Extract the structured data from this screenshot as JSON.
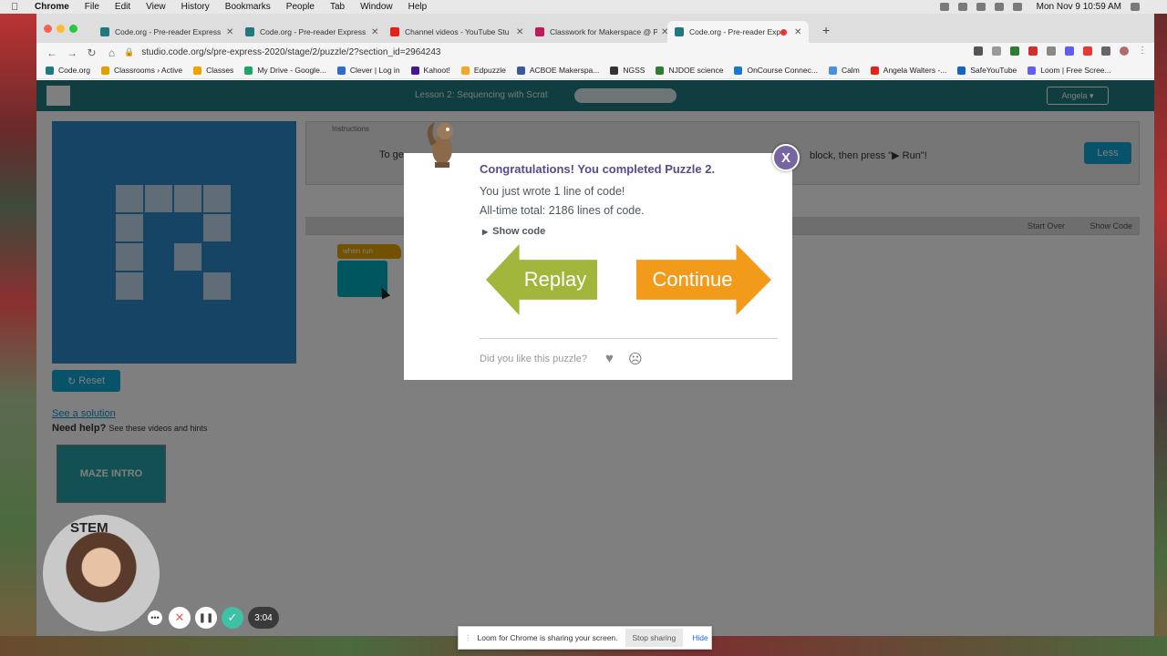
{
  "menubar": {
    "app": "Chrome",
    "items": [
      "File",
      "Edit",
      "View",
      "History",
      "Bookmarks",
      "People",
      "Tab",
      "Window",
      "Help"
    ],
    "clock": "Mon Nov 9  10:59 AM"
  },
  "tabs": [
    {
      "title": "Code.org - Pre-reader Express",
      "color": "#1e7a80"
    },
    {
      "title": "Code.org - Pre-reader Express",
      "color": "#1e7a80"
    },
    {
      "title": "Channel videos - YouTube Stu",
      "color": "#e62117"
    },
    {
      "title": "Classwork for Makerspace @ P",
      "color": "#c2185b"
    },
    {
      "title": "Code.org - Pre-reader Exp",
      "color": "#1e7a80",
      "active": true
    }
  ],
  "address_bar": {
    "url": "studio.code.org/s/pre-express-2020/stage/2/puzzle/2?section_id=2964243"
  },
  "bookmarks": [
    {
      "label": "Code.org",
      "color": "#1e7a80"
    },
    {
      "label": "Classrooms › Active",
      "color": "#e0a000"
    },
    {
      "label": "Classes",
      "color": "#f4a100"
    },
    {
      "label": "My Drive - Google...",
      "color": "#1fa463"
    },
    {
      "label": "Clever | Log in",
      "color": "#2d6bcd"
    },
    {
      "label": "Kahoot!",
      "color": "#46178f"
    },
    {
      "label": "Edpuzzle",
      "color": "#f5a623"
    },
    {
      "label": "ACBOE Makerspa...",
      "color": "#3b5998"
    },
    {
      "label": "NGSS",
      "color": "#333333"
    },
    {
      "label": "NJDOE science",
      "color": "#2e7d32"
    },
    {
      "label": "OnCourse Connec...",
      "color": "#1976d2"
    },
    {
      "label": "Calm",
      "color": "#4a90e2"
    },
    {
      "label": "Angela Walters -...",
      "color": "#e62117"
    },
    {
      "label": "SafeYouTube",
      "color": "#1565c0"
    },
    {
      "label": "Loom | Free Scree...",
      "color": "#625df5"
    }
  ],
  "page": {
    "lesson_title": "Lesson 2: Sequencing with Scrat",
    "progress_current": "2",
    "user_name": "Angela",
    "instructions_tab": "Instructions",
    "instructions_start": "To ge",
    "instructions_end": "block, then press \"▶ Run\"!",
    "less_button": "Less",
    "start_over": "Start Over",
    "show_code_ws": "Show Code",
    "when_run_block": "when run",
    "reset_button": "Reset",
    "see_solution": "See a solution",
    "need_help": "Need help?",
    "need_help_sub": "See these videos and hints",
    "video_title": "MAZE INTRO"
  },
  "modal": {
    "title": "Congratulations! You completed Puzzle 2.",
    "line1": "You just wrote 1 line of code!",
    "line2": "All-time total: 2186 lines of code.",
    "show_code": "Show code",
    "replay_label": "Replay",
    "continue_label": "Continue",
    "feedback_prompt": "Did you like this puzzle?",
    "close_label": "X"
  },
  "loom": {
    "timer": "3:04",
    "webcam_badge": "STEM",
    "share_message": "Loom for Chrome is sharing your screen.",
    "stop_sharing": "Stop sharing",
    "hide": "Hide"
  }
}
